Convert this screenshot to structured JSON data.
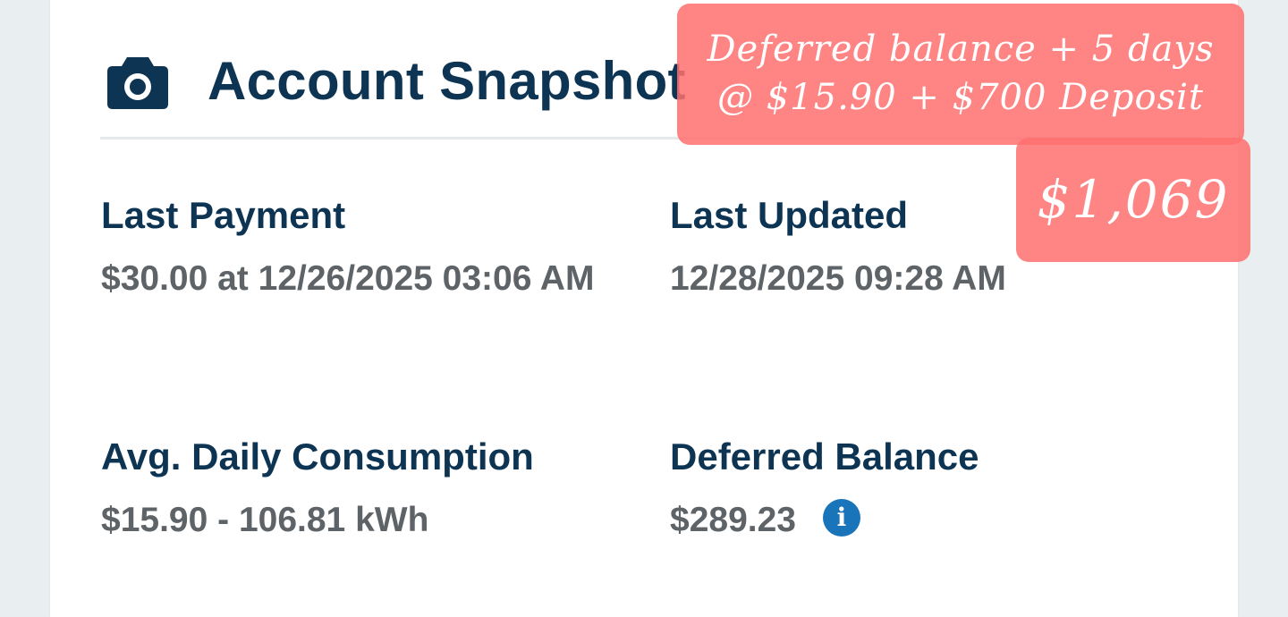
{
  "card": {
    "title": "Account Snapshot",
    "header_icon": "camera-icon"
  },
  "fields": {
    "last_payment": {
      "label": "Last Payment",
      "value": "$30.00 at 12/26/2025 03:06 AM"
    },
    "last_updated": {
      "label": "Last Updated",
      "value": "12/28/2025 09:28 AM"
    },
    "avg_daily": {
      "label": "Avg. Daily Consumption",
      "value": "$15.90 - 106.81 kWh"
    },
    "deferred_balance": {
      "label": "Deferred Balance",
      "value": "$289.23",
      "info_icon": "info-icon",
      "info_glyph": "i"
    }
  },
  "annotations": {
    "note_line1": "Deferred balance + 5 days",
    "note_line2": "@ $15.90 + $700 Deposit",
    "amount": "$1,069"
  },
  "colors": {
    "heading": "#0d3452",
    "value_text": "#5e6367",
    "info_icon": "#1a74b9",
    "annotation_bg": "#ff7070",
    "background": "#e9eef1"
  }
}
